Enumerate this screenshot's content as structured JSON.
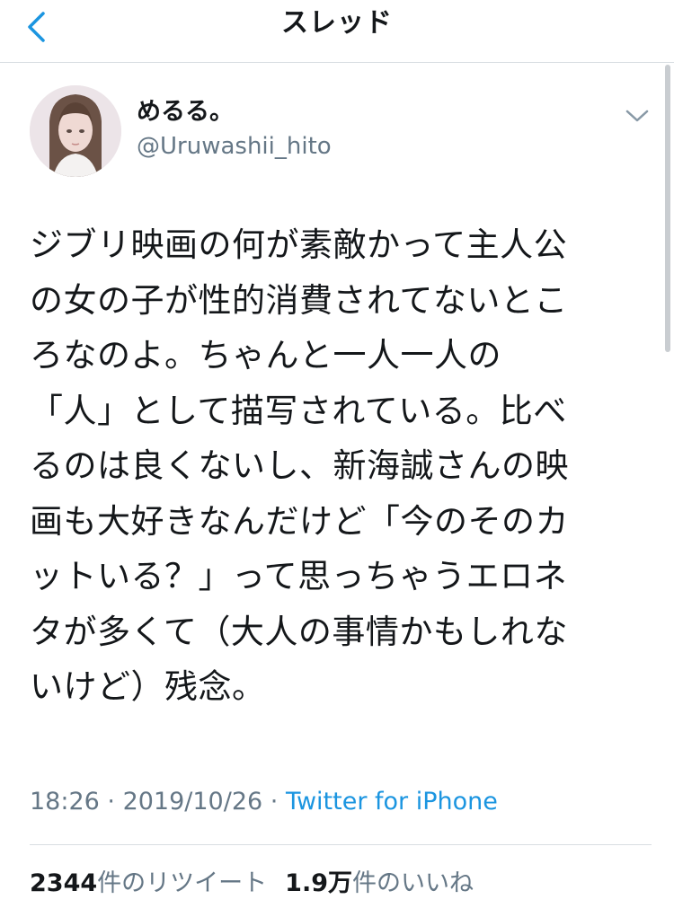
{
  "header": {
    "title": "スレッド",
    "back_icon": "chevron-left-icon"
  },
  "tweet": {
    "author": {
      "display_name": "めるる。",
      "handle": "@Uruwashii_hito"
    },
    "menu_icon": "chevron-down-icon",
    "text": "ジブリ映画の何が素敵かって主人公\nの女の子が性的消費されてないとこ\nろなのよ。ちゃんと一人一人の\n「人」として描写されている。比べ\nるのは良くないし、新海誠さんの映\n画も大好きなんだけど「今のそのカ\nットいる？」って思っちゃうエロネ\nタが多くて（大人の事情かもしれな\nいけど）残念。",
    "time": "18:26",
    "sep1": " · ",
    "date": "2019/10/26",
    "sep2": " · ",
    "source": "Twitter for iPhone",
    "retweet_count": "2344",
    "retweet_label": "件のリツイート",
    "like_count": "1.9万",
    "like_label": "件のいいね"
  },
  "colors": {
    "accent": "#1b95e0",
    "secondary_text": "#657786",
    "primary_text": "#14171a",
    "divider": "#d8dde1"
  }
}
